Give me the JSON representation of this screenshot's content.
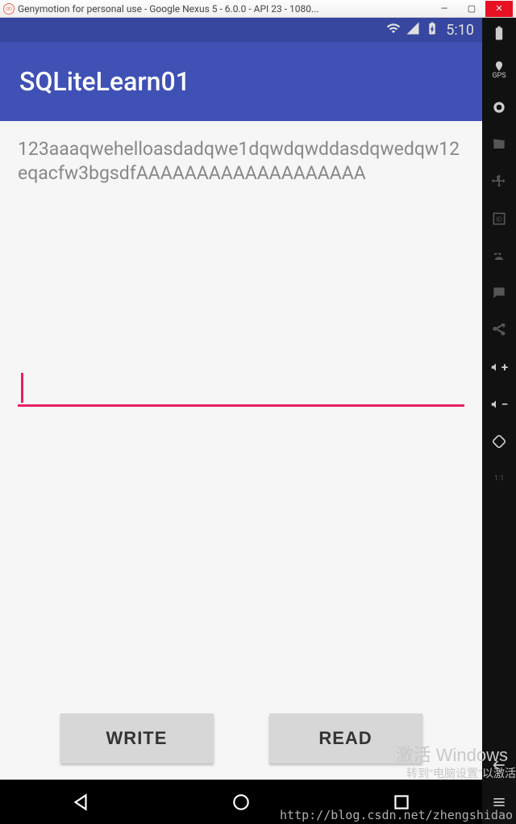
{
  "window": {
    "title": "Genymotion for personal use - Google Nexus 5 - 6.0.0 - API 23 - 1080..."
  },
  "statusbar": {
    "time": "5:10"
  },
  "appbar": {
    "title": "SQLiteLearn01"
  },
  "content": {
    "output": "123aaaqwehelloasdadqwe1dqwdqwddasdqwedqw12eqacfw3bgsdfAAAAAAAAAAAAAAAAAAA",
    "input_value": ""
  },
  "buttons": {
    "write": "WRITE",
    "read": "READ"
  },
  "sidebar": {
    "gps_label": "GPS"
  },
  "watermark": {
    "line1": "激活 Windows",
    "line2": "转到\"电脑设置\"以激活",
    "url": "http://blog.csdn.net/zhengshidao"
  }
}
